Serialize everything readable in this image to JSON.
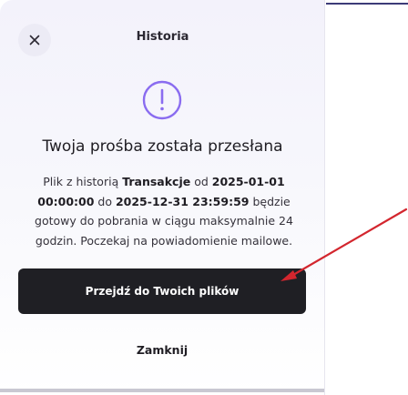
{
  "dialog": {
    "title": "Historia",
    "heading": "Twoja prośba została przesłana",
    "message": {
      "part1": "Plik z historią ",
      "history_type": "Transakcje",
      "part2": " od ",
      "date_from": "2025-01-01 00:00:00",
      "part3": " do ",
      "date_to": "2025-12-31 23:59:59",
      "part4": " będzie gotowy do pobrania w ciągu maksymalnie 24 godzin. Poczekaj na powiadomienie mailowe."
    },
    "primary_button": "Przejdź do Twoich plików",
    "secondary_button": "Zamknij"
  },
  "icons": {
    "close": "close-icon",
    "status": "alert-circle-icon"
  },
  "colors": {
    "accent": "#8a6cf0",
    "primary_button_bg": "#1f1f24",
    "annotation_arrow": "#d3262e"
  }
}
